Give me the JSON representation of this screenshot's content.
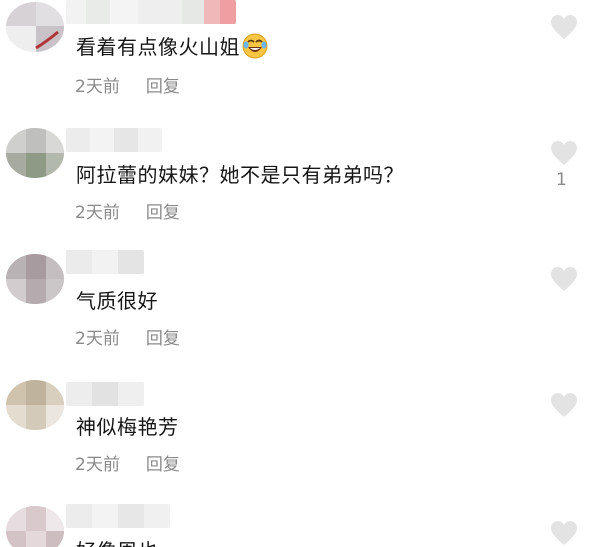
{
  "comments": [
    {
      "text": "看着有点像火山姐",
      "time": "2天前",
      "reply": "回复",
      "like_count": "",
      "emoji": "rolling-on-floor-laughing"
    },
    {
      "text": "阿拉蕾的妹妹？她不是只有弟弟吗？",
      "time": "2天前",
      "reply": "回复",
      "like_count": "1"
    },
    {
      "text": "气质很好",
      "time": "2天前",
      "reply": "回复",
      "like_count": ""
    },
    {
      "text": "神似梅艳芳",
      "time": "2天前",
      "reply": "回复",
      "like_count": ""
    },
    {
      "text": "好像周也",
      "time": "",
      "reply": "",
      "like_count": ""
    }
  ],
  "colors": {
    "text": "#161616",
    "meta": "#8a8a8a",
    "heart": "#e3e3e3"
  }
}
